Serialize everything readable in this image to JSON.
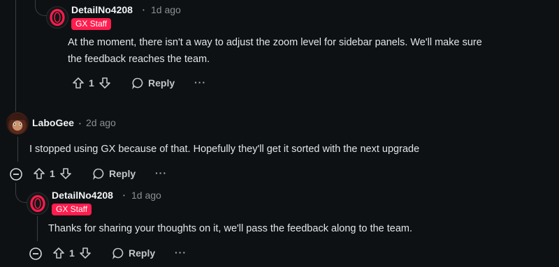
{
  "comments": [
    {
      "author": "DetailNo4208",
      "time": "1d ago",
      "badge": "GX Staff",
      "text_lines": [
        "At the moment, there isn't a way to adjust the zoom level for sidebar panels. We'll make sure",
        "the feedback reaches the team."
      ],
      "votes": "1",
      "reply_label": "Reply",
      "more": "···"
    },
    {
      "author": "LaboGee",
      "time": "2d ago",
      "text_lines": [
        "I stopped using GX because of that. Hopefully they'll get it sorted with the next upgrade"
      ],
      "votes": "1",
      "reply_label": "Reply",
      "more": "···"
    },
    {
      "author": "DetailNo4208",
      "time": "1d ago",
      "badge": "GX Staff",
      "text_lines": [
        "Thanks for sharing your thoughts on it, we'll pass the feedback along to the team."
      ],
      "votes": "1",
      "reply_label": "Reply",
      "more": "···"
    }
  ],
  "separator": "•",
  "icons": {
    "upvote": "upvote-arrow-icon",
    "downvote": "downvote-arrow-icon",
    "reply": "speech-bubble-icon",
    "collapse": "collapse-minus-icon",
    "staff_avatar": "opera-gx-logo-icon"
  },
  "colors": {
    "background": "#0e1113",
    "badge": "#ff1d4e",
    "opera_red": "#ff1b4d"
  }
}
